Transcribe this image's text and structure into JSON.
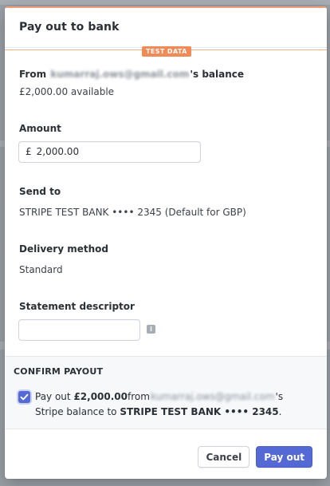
{
  "modal": {
    "title": "Pay out to bank",
    "test_badge": "TEST DATA"
  },
  "from": {
    "label_prefix": "From ",
    "email": "kumarraj.ows@gmail.com",
    "label_suffix": "'s balance",
    "available": "£2,000.00 available"
  },
  "amount": {
    "label": "Amount",
    "currency_symbol": "£",
    "value": "2,000.00"
  },
  "send_to": {
    "label": "Send to",
    "value": "STRIPE TEST BANK •••• 2345 (Default for GBP)"
  },
  "delivery": {
    "label": "Delivery method",
    "value": "Standard"
  },
  "statement": {
    "label": "Statement descriptor",
    "value": "",
    "info_icon": "info-icon"
  },
  "confirm": {
    "title": "CONFIRM PAYOUT",
    "checked": true,
    "text_prefix": "Pay out ",
    "amount": "£2,000.00",
    "text_from": "from",
    "email": "kumarraj.ows@gmail.com",
    "text_mid": "'s Stripe balance to ",
    "bank": "STRIPE TEST BANK •••• 2345",
    "text_end": "."
  },
  "buttons": {
    "cancel": "Cancel",
    "pay_out": "Pay out"
  },
  "colors": {
    "primary": "#5469d4",
    "test_badge": "#f08a56"
  }
}
